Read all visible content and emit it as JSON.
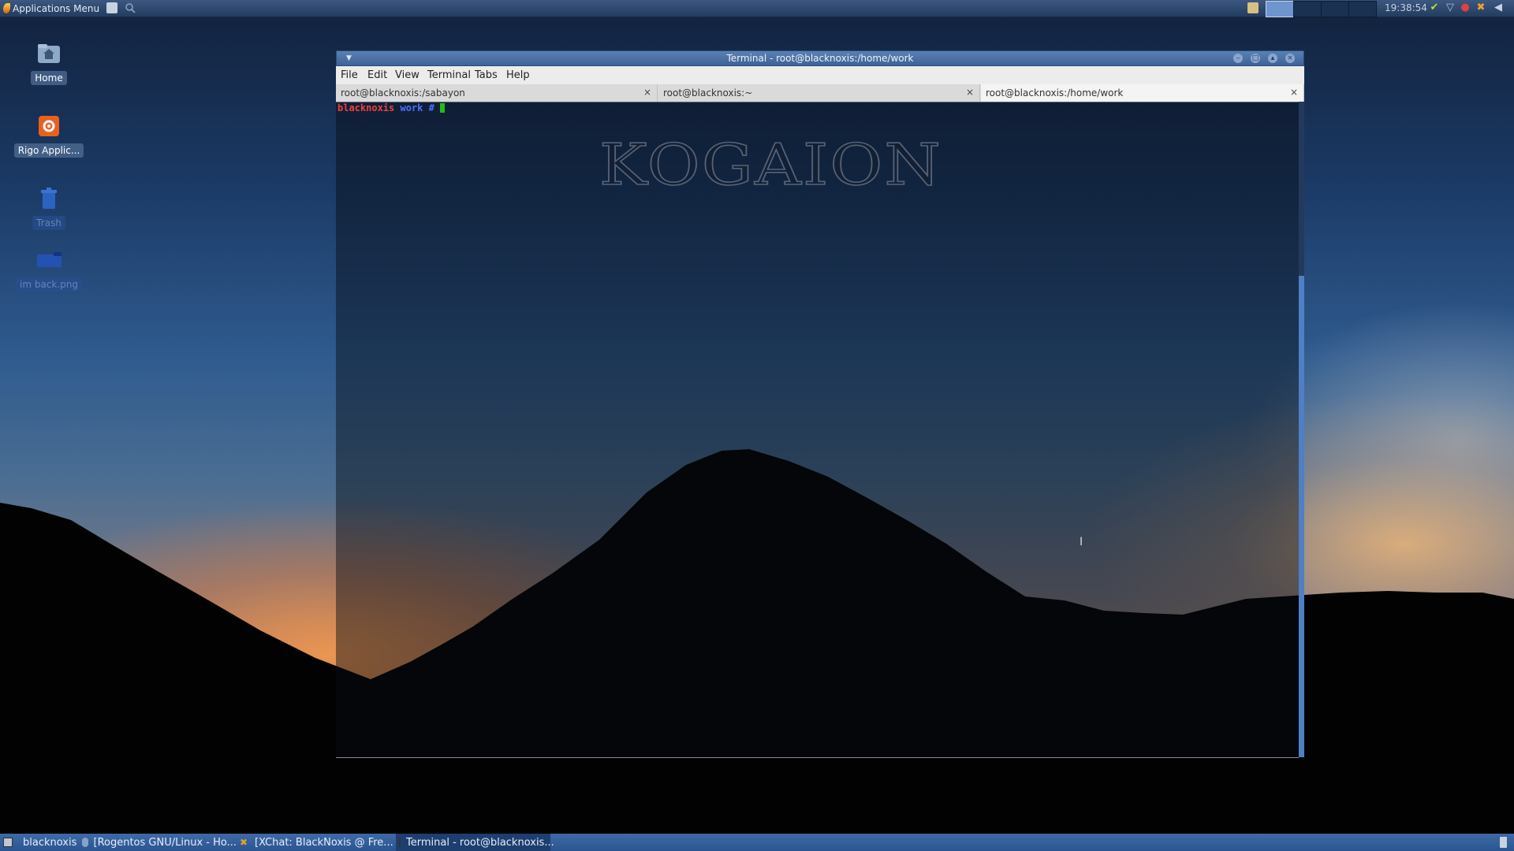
{
  "top_panel": {
    "app_menu_label": "Applications Menu",
    "clock": "19:38:54",
    "workspaces": [
      {
        "active": true
      },
      {
        "active": false
      },
      {
        "active": false
      },
      {
        "active": false
      }
    ]
  },
  "desktop_icons": [
    {
      "label": "Home",
      "icon": "home-folder-icon"
    },
    {
      "label": "Rigo Applic...",
      "icon": "rigo-applications-icon"
    },
    {
      "label": "Trash",
      "icon": "trash-icon"
    },
    {
      "label": "im back.png",
      "icon": "image-file-icon"
    }
  ],
  "terminal": {
    "window_title": "Terminal - root@blacknoxis:/home/work",
    "menu": [
      "File",
      "Edit",
      "View",
      "Terminal",
      "Tabs",
      "Help"
    ],
    "tabs": [
      {
        "label": "root@blacknoxis:/sabayon",
        "close": "×",
        "active": false
      },
      {
        "label": "root@blacknoxis:~",
        "close": "×",
        "active": false
      },
      {
        "label": "root@blacknoxis:/home/work",
        "close": "×",
        "active": true
      }
    ],
    "prompt_host": "blacknoxis",
    "prompt_dir": "work #",
    "watermark": "KOGAION"
  },
  "taskbar": {
    "tasks": [
      {
        "label": "blacknoxis",
        "icon": "terminal-icon"
      },
      {
        "label": "[Rogentos GNU/Linux - Ho...",
        "icon": "browser-icon"
      },
      {
        "label": "[XChat: BlackNoxis @ Fre...",
        "icon": "xchat-icon"
      },
      {
        "label": "Terminal - root@blacknoxis...",
        "icon": "terminal-icon"
      }
    ]
  },
  "colors": {
    "panel": "#2f4b73",
    "prompt_host": "#f04040",
    "prompt_dir": "#4c70ff",
    "cursor": "#19c019",
    "scroll_thumb": "#4f7fc4"
  }
}
